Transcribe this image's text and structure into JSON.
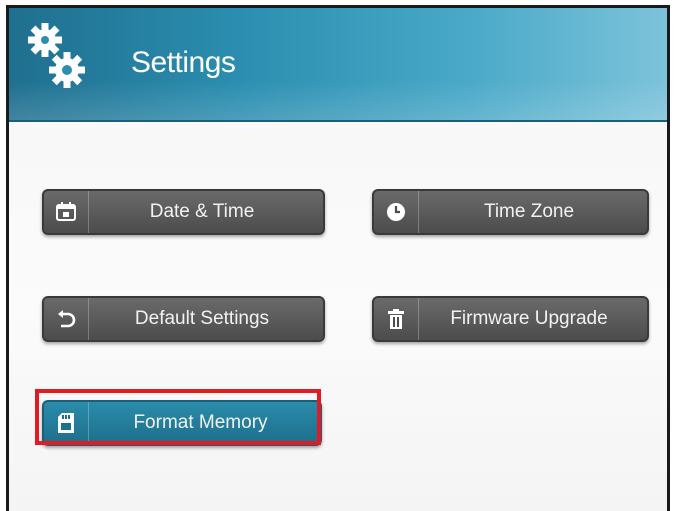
{
  "header": {
    "title": "Settings",
    "icon": "gears-icon"
  },
  "buttons": [
    {
      "id": "date-time",
      "label": "Date & Time",
      "icon": "calendar-icon"
    },
    {
      "id": "time-zone",
      "label": "Time Zone",
      "icon": "clock-icon"
    },
    {
      "id": "default-settings",
      "label": "Default Settings",
      "icon": "undo-icon"
    },
    {
      "id": "firmware-upgrade",
      "label": "Firmware Upgrade",
      "icon": "trash-icon"
    },
    {
      "id": "format-memory",
      "label": "Format Memory",
      "icon": "memory-card-icon",
      "selected": true
    }
  ],
  "colors": {
    "header": "#2b8eb0",
    "button": "#555555",
    "selected_button": "#1d6f8b",
    "highlight": "#e11b22"
  }
}
